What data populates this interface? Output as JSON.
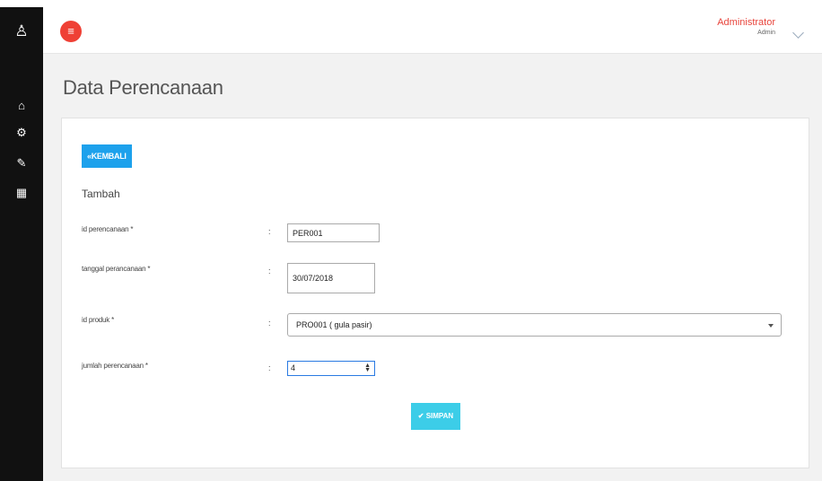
{
  "sidebar": {
    "items": [
      {
        "name": "user-icon",
        "glyph": "♙"
      },
      {
        "name": "home-icon",
        "glyph": "⌂"
      },
      {
        "name": "gears-icon",
        "glyph": "⚙"
      },
      {
        "name": "edit-icon",
        "glyph": "✎"
      },
      {
        "name": "calendar-icon",
        "glyph": "▦"
      }
    ]
  },
  "header": {
    "menu_icon": "≡",
    "user_name": "Administrator",
    "user_role": "Admin"
  },
  "page": {
    "title": "Data Perencanaan"
  },
  "form": {
    "back_label": "«KEMBALI",
    "section_label": "Tambah",
    "separator": ":",
    "fields": {
      "id_perencanaan": {
        "label": "id perencanaan *",
        "value": "PER001"
      },
      "tanggal_perencanaan": {
        "label": "tanggal perancanaan *",
        "value": "30/07/2018"
      },
      "id_produk": {
        "label": "id produk *",
        "value": "PRO001 ( gula pasir)"
      },
      "jumlah_perencanaan": {
        "label": "jumlah perencanaan *",
        "value": "4"
      }
    },
    "save_label": "✔ SIMPAN"
  },
  "colors": {
    "sidebar_bg": "#111111",
    "menu_button": "#ef4035",
    "user_name": "#e8453c",
    "back_button": "#1da1ec",
    "save_button": "#3ccde8"
  }
}
